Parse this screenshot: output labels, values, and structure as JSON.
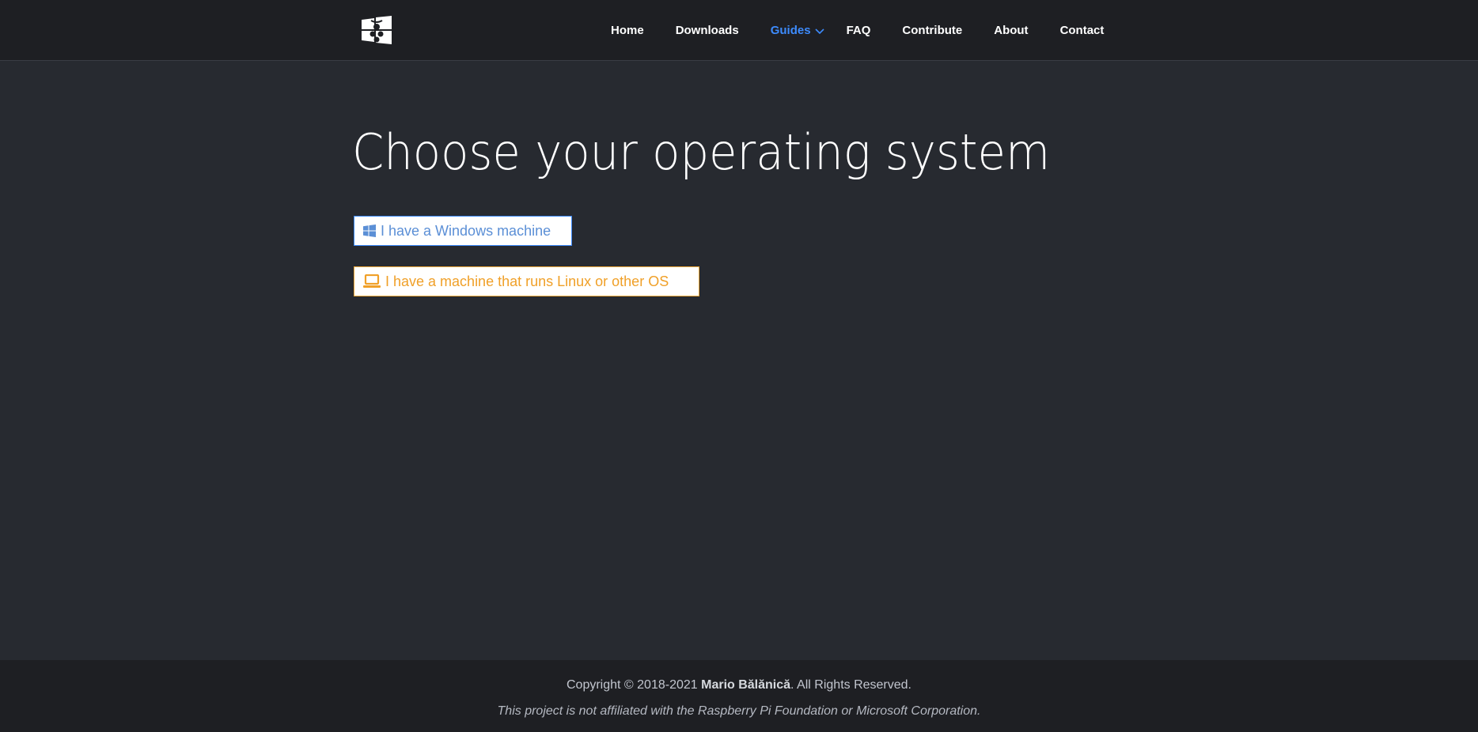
{
  "header": {
    "logo_name": "windows-raspberry-logo",
    "nav": [
      {
        "label": "Home",
        "active": false
      },
      {
        "label": "Downloads",
        "active": false
      },
      {
        "label": "Guides",
        "active": true,
        "has_dropdown": true
      },
      {
        "label": "FAQ",
        "active": false
      },
      {
        "label": "Contribute",
        "active": false
      },
      {
        "label": "About",
        "active": false
      },
      {
        "label": "Contact",
        "active": false
      }
    ]
  },
  "main": {
    "title": "Choose your operating system",
    "buttons": [
      {
        "label": "I have a Windows machine",
        "icon": "windows-icon",
        "color": "#3d8bfd"
      },
      {
        "label": "I have a machine that runs Linux or other OS",
        "icon": "laptop-icon",
        "color": "#f0a028"
      }
    ]
  },
  "footer": {
    "copyright_prefix": "Copyright © 2018-2021 ",
    "author": "Mario Bălănică",
    "copyright_suffix": ". All Rights Reserved.",
    "disclaimer": "This project is not affiliated with the Raspberry Pi Foundation or Microsoft Corporation."
  },
  "colors": {
    "background": "#272a30",
    "header_bg": "#1e1f23",
    "accent": "#3d8bfd"
  }
}
